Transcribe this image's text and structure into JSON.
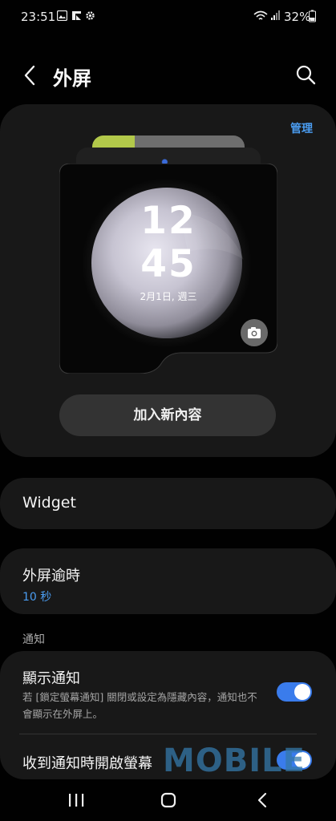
{
  "status_bar": {
    "time": "23:51",
    "battery": "32%",
    "icons": [
      "gallery-icon",
      "flipboard-icon",
      "settings-gear-icon",
      "wifi-icon",
      "signal-icon",
      "battery-icon"
    ]
  },
  "header": {
    "title": "外屏",
    "back_icon": "chevron-left-icon",
    "search_icon": "search-icon"
  },
  "preview": {
    "manage_label": "管理",
    "clock_hour": "12",
    "clock_minute": "45",
    "date": "2月1日, 週三",
    "camera_icon": "camera-icon",
    "add_button_label": "加入新內容"
  },
  "widget": {
    "label": "Widget"
  },
  "timeout": {
    "label": "外屏逾時",
    "value": "10 秒"
  },
  "notifications": {
    "section_header": "通知",
    "show_label": "顯示通知",
    "show_description": "若 [鎖定螢幕通知] 關閉或設定為隱藏內容，通知也不會顯示在外屏上。",
    "show_enabled": true,
    "wake_label": "收到通知時開啟螢幕",
    "wake_enabled": true
  },
  "watermark": "MOBILE",
  "nav_bar": {
    "icons": [
      "recents-icon",
      "home-icon",
      "back-icon"
    ]
  },
  "colors": {
    "accent": "#4a9cf0",
    "toggle_on": "#3a7cec",
    "card_bg": "#181818",
    "page_bg": "#010101"
  }
}
